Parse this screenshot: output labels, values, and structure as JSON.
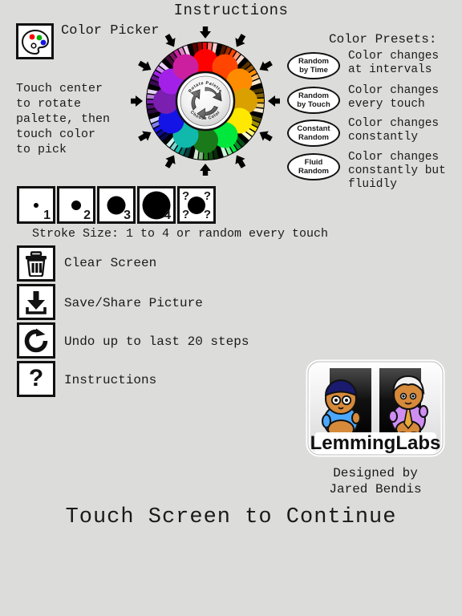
{
  "page": {
    "title": "Instructions",
    "background_color": "#dcdcda",
    "cta": "Touch Screen to Continue"
  },
  "color_picker": {
    "icon_name": "palette-icon",
    "label": "Color Picker",
    "help_text": "Touch center\nto rotate\npalette, then\ntouch color\nto pick",
    "hub_top_text": "Rotate Palette",
    "hub_bottom_text": "Choose Color",
    "wheel_colors": [
      "#ff0000",
      "#ff4500",
      "#ff8c00",
      "#daa000",
      "#ffe800",
      "#00e83c",
      "#1a7a1a",
      "#11b8ac",
      "#1414e6",
      "#7a1fb0",
      "#a320e8",
      "#cc1fa0"
    ]
  },
  "presets": {
    "title": "Color Presets:",
    "items": [
      {
        "name": "Random",
        "name2": "by Time",
        "desc": "Color changes\nat intervals"
      },
      {
        "name": "Random",
        "name2": "by Touch",
        "desc": "Color changes\nevery touch"
      },
      {
        "name": "Constant",
        "name2": "Random",
        "desc": "Color changes\nconstantly"
      },
      {
        "name": "Fluid",
        "name2": "Random",
        "desc": "Color changes\nconstantly but\nfluidly"
      }
    ]
  },
  "stroke": {
    "caption": "Stroke Size: 1 to 4 or random every touch",
    "sizes": [
      {
        "label": "1",
        "dot": 6
      },
      {
        "label": "2",
        "dot": 12
      },
      {
        "label": "3",
        "dot": 22
      },
      {
        "label": "4",
        "dot": 33
      },
      {
        "label": "?",
        "dot": 22
      }
    ],
    "random_marks": [
      "?",
      "?",
      "?",
      "?"
    ]
  },
  "actions": [
    {
      "icon": "trash-icon",
      "label": "Clear Screen"
    },
    {
      "icon": "download-icon",
      "label": "Save/Share Picture"
    },
    {
      "icon": "redo-icon",
      "label": "Undo up to last 20 steps"
    },
    {
      "icon": "question-icon",
      "label": "Instructions"
    }
  ],
  "logo": {
    "brand": "LemmingLabs",
    "credit": "Designed by\nJared Bendis"
  }
}
